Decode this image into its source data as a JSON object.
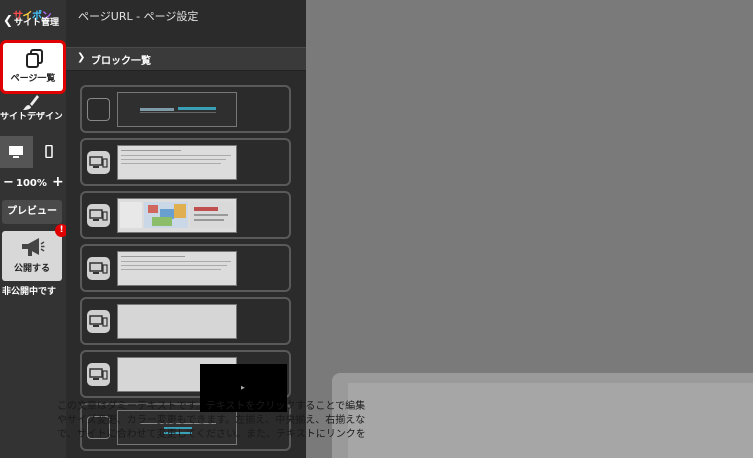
{
  "toolbar": {
    "back_logo": [
      "サ",
      "イ",
      "ポ",
      "ン"
    ],
    "back_label": "サイト管理",
    "pages_label": "ページ一覧",
    "design_label": "サイトデザイン",
    "zoom_minus": "−",
    "zoom_value": "100%",
    "zoom_plus": "+",
    "preview_label": "プレビュー",
    "publish_label": "公開する",
    "alert_badge": "!",
    "status_text": "非公開中です"
  },
  "panel": {
    "title": "ページURL - ページ設定",
    "section_label": "ブロック一覧"
  },
  "canvas": {
    "lines": [
      "この文章はダミーテキストです。テキストをクリックすることで編集",
      "やサイズ変更、カラー変更もできます。左揃え、中央揃え、右揃えな",
      "で、サイトに合わせて変更してください。また、テキストにリンクを"
    ]
  },
  "colors": {
    "toolbar_bg": "#333333",
    "panel_bg": "#2b2b2b",
    "highlight": "#e00000",
    "canvas_bg": "#7a7a7a"
  }
}
